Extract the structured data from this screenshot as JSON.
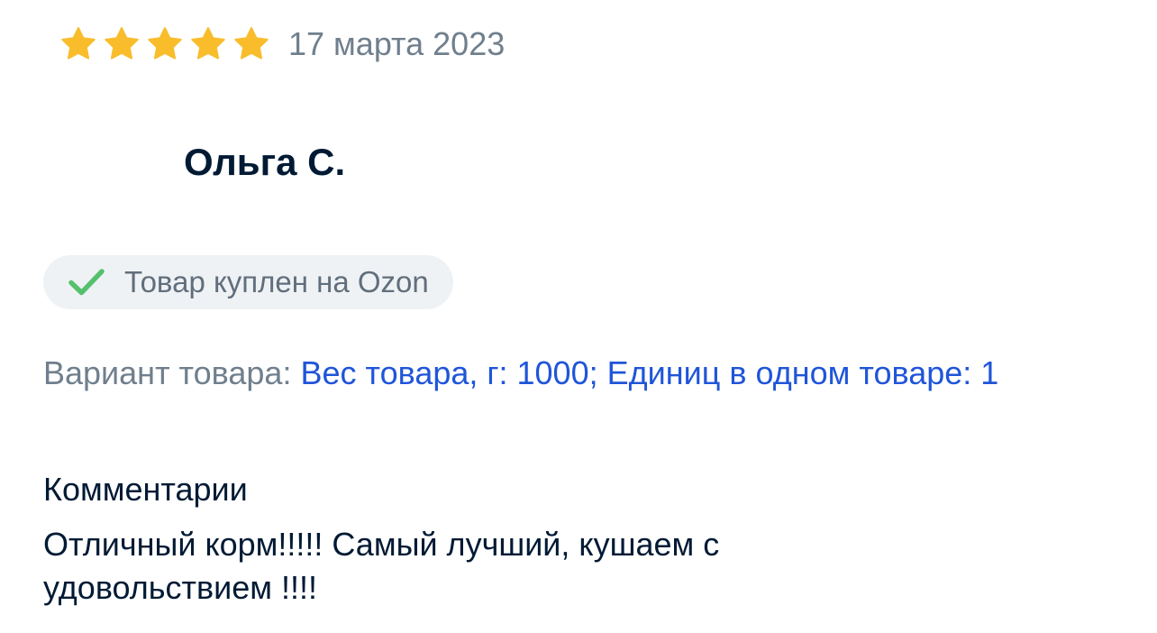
{
  "review": {
    "rating": {
      "value": 5,
      "max": 5,
      "star_color": "#f9bd2c"
    },
    "date": "17 марта 2023",
    "author": "Ольга С.",
    "verified": {
      "label": "Товар куплен на Ozon",
      "icon": "check-icon",
      "icon_color": "#55c16d"
    },
    "variant": {
      "label": "Вариант товара: ",
      "value": "Вес товара, г: 1000; Единиц в одном товаре: 1",
      "value_color": "#1f55d9"
    },
    "comments": {
      "heading": "Комментарии",
      "text": "Отличный корм!!!!! Самый лучший, кушаем с удовольствием !!!!"
    }
  }
}
